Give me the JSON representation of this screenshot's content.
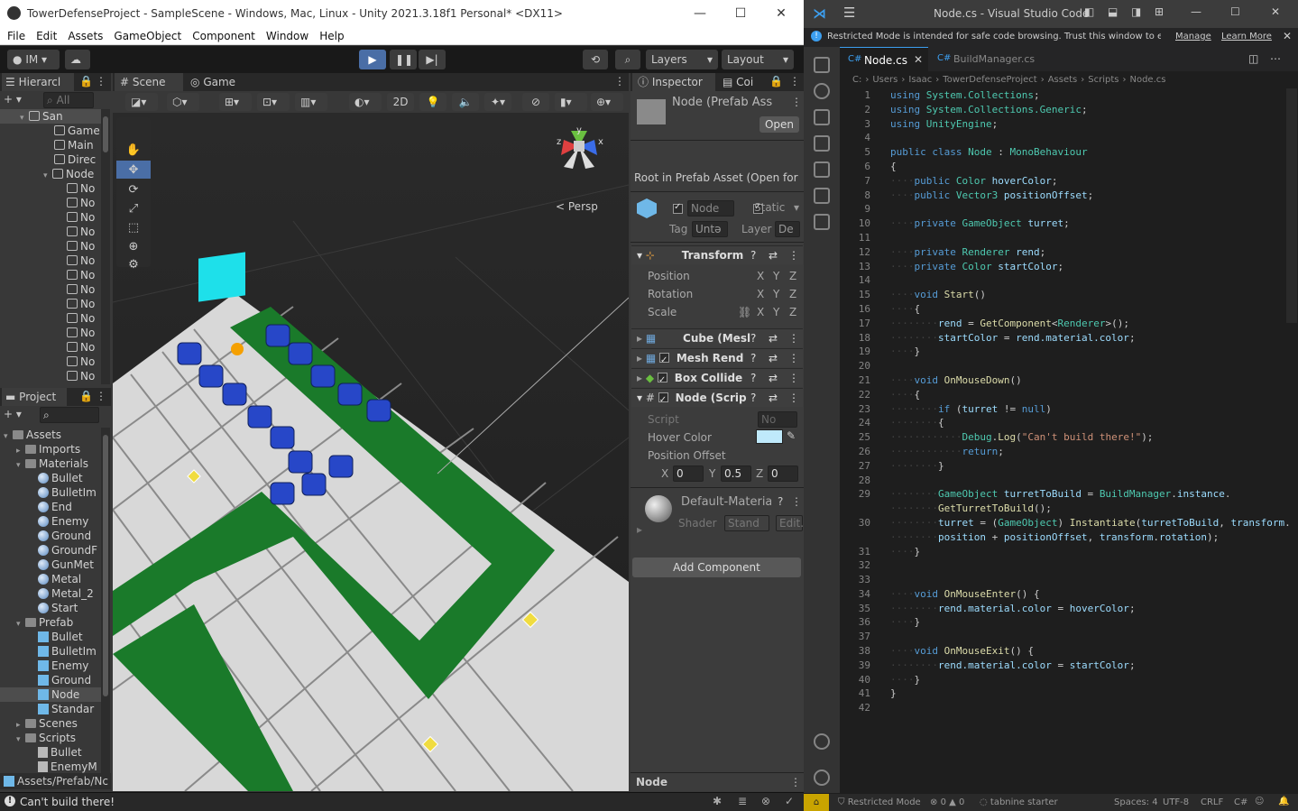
{
  "unity": {
    "title": "TowerDefenseProject - SampleScene - Windows, Mac, Linux - Unity 2021.3.18f1 Personal* <DX11>",
    "menu": [
      "File",
      "Edit",
      "Assets",
      "GameObject",
      "Component",
      "Window",
      "Help"
    ],
    "toolbar": {
      "account": "IM",
      "layers": "Layers",
      "layout": "Layout"
    },
    "hierarchy": {
      "tab": "Hierarcl",
      "search": "All",
      "scene": "San",
      "items": [
        "Game",
        "Main",
        "Direc",
        "Node",
        "No",
        "No",
        "No",
        "No",
        "No",
        "No",
        "No",
        "No",
        "No",
        "No",
        "No",
        "No",
        "No",
        "No"
      ]
    },
    "scene": {
      "tab_scene": "Scene",
      "tab_game": "Game",
      "btn_2d": "2D",
      "persp": "Persp",
      "axis_y": "y",
      "axis_x": "x",
      "axis_z": "z"
    },
    "project": {
      "tab": "Project",
      "tree": [
        {
          "label": "Assets",
          "kind": "folder",
          "level": 0
        },
        {
          "label": "Imports",
          "kind": "folder",
          "level": 1
        },
        {
          "label": "Materials",
          "kind": "folder",
          "level": 1
        },
        {
          "label": "Bullet",
          "kind": "mat",
          "level": 2
        },
        {
          "label": "BulletIm",
          "kind": "mat",
          "level": 2
        },
        {
          "label": "End",
          "kind": "mat",
          "level": 2
        },
        {
          "label": "Enemy",
          "kind": "mat",
          "level": 2
        },
        {
          "label": "Ground",
          "kind": "mat",
          "level": 2
        },
        {
          "label": "GroundF",
          "kind": "mat",
          "level": 2
        },
        {
          "label": "GunMet",
          "kind": "mat",
          "level": 2
        },
        {
          "label": "Metal",
          "kind": "mat",
          "level": 2
        },
        {
          "label": "Metal_2",
          "kind": "mat",
          "level": 2
        },
        {
          "label": "Start",
          "kind": "mat",
          "level": 2
        },
        {
          "label": "Prefab",
          "kind": "folder",
          "level": 1
        },
        {
          "label": "Bullet",
          "kind": "pref",
          "level": 2
        },
        {
          "label": "BulletIm",
          "kind": "pref",
          "level": 2
        },
        {
          "label": "Enemy",
          "kind": "pref",
          "level": 2
        },
        {
          "label": "Ground",
          "kind": "pref",
          "level": 2
        },
        {
          "label": "Node",
          "kind": "pref",
          "level": 2
        },
        {
          "label": "Standar",
          "kind": "pref",
          "level": 2
        },
        {
          "label": "Scenes",
          "kind": "folder",
          "level": 1
        },
        {
          "label": "Scripts",
          "kind": "folder",
          "level": 1
        },
        {
          "label": "Bullet",
          "kind": "scr",
          "level": 2
        },
        {
          "label": "EnemyM",
          "kind": "scr",
          "level": 2
        }
      ],
      "path": "Assets/Prefab/Nc"
    },
    "inspector": {
      "tab": "Inspector",
      "tab2": "Coi",
      "prefab_name": "Node (Prefab Ass",
      "open_btn": "Open",
      "root_msg": "Root in Prefab Asset (Open for fu",
      "obj_name": "Node",
      "static_label": "Static",
      "tag_label": "Tag",
      "tag_value": "Untǝ",
      "layer_label": "Layer",
      "layer_value": "De",
      "transform": "Transform",
      "position": "Position",
      "rotation": "Rotation",
      "scale": "Scale",
      "x": "X",
      "y": "Y",
      "z": "Z",
      "cube": "Cube (Mesl",
      "mesh_renderer": "Mesh Rend",
      "box_collider": "Box Collide",
      "node_script": "Node (Scrip",
      "script_label": "Script",
      "script_value": "No",
      "hover_color_label": "Hover Color",
      "hover_color": "#bfe9fb",
      "position_offset_label": "Position Offset",
      "offset": {
        "x": "0",
        "y": "0.5",
        "z": "0"
      },
      "material": "Default-Materia",
      "shader_label": "Shader",
      "shader_value": "Stand",
      "edit": "Edit.",
      "add_component": "Add Component",
      "footer": "Node"
    },
    "status": "Can't build there!"
  },
  "vscode": {
    "title": "Node.cs - Visual Studio Code",
    "banner": "Restricted Mode is intended for safe code browsing. Trust this window to enable all...",
    "banner_manage": "Manage",
    "banner_learn": "Learn More",
    "tabs": [
      {
        "label": "Node.cs",
        "active": true
      },
      {
        "label": "BuildManager.cs",
        "active": false
      }
    ],
    "breadcrumb": [
      "C:",
      "Users",
      "Isaac",
      "TowerDefenseProject",
      "Assets",
      "Scripts",
      "Node.cs"
    ],
    "code": [
      [
        [
          "using",
          "kw"
        ],
        [
          " ",
          ""
        ],
        [
          "System.Collections",
          "ty"
        ],
        [
          ";",
          ""
        ]
      ],
      [
        [
          "using",
          "kw"
        ],
        [
          " ",
          ""
        ],
        [
          "System.Collections.Generic",
          "ty"
        ],
        [
          ";",
          ""
        ]
      ],
      [
        [
          "using",
          "kw"
        ],
        [
          " ",
          ""
        ],
        [
          "UnityEngine",
          "ty"
        ],
        [
          ";",
          ""
        ]
      ],
      [],
      [
        [
          "public",
          "kw"
        ],
        [
          " ",
          ""
        ],
        [
          "class",
          "kw"
        ],
        [
          " ",
          ""
        ],
        [
          "Node",
          "ty"
        ],
        [
          " : ",
          ""
        ],
        [
          "MonoBehaviour",
          "ty"
        ]
      ],
      [
        [
          "{",
          ""
        ]
      ],
      [
        [
          "····",
          "ws"
        ],
        [
          "public",
          "kw"
        ],
        [
          " ",
          ""
        ],
        [
          "Color",
          "ty"
        ],
        [
          " ",
          ""
        ],
        [
          "hoverColor",
          "vr"
        ],
        [
          ";",
          ""
        ]
      ],
      [
        [
          "····",
          "ws"
        ],
        [
          "public",
          "kw"
        ],
        [
          " ",
          ""
        ],
        [
          "Vector3",
          "ty"
        ],
        [
          " ",
          ""
        ],
        [
          "positionOffset",
          "vr"
        ],
        [
          ";",
          ""
        ]
      ],
      [],
      [
        [
          "····",
          "ws"
        ],
        [
          "private",
          "kw"
        ],
        [
          " ",
          ""
        ],
        [
          "GameObject",
          "ty"
        ],
        [
          " ",
          ""
        ],
        [
          "turret",
          "vr"
        ],
        [
          ";",
          ""
        ]
      ],
      [],
      [
        [
          "····",
          "ws"
        ],
        [
          "private",
          "kw"
        ],
        [
          " ",
          ""
        ],
        [
          "Renderer",
          "ty"
        ],
        [
          " ",
          ""
        ],
        [
          "rend",
          "vr"
        ],
        [
          ";",
          ""
        ]
      ],
      [
        [
          "····",
          "ws"
        ],
        [
          "private",
          "kw"
        ],
        [
          " ",
          ""
        ],
        [
          "Color",
          "ty"
        ],
        [
          " ",
          ""
        ],
        [
          "startColor",
          "vr"
        ],
        [
          ";",
          ""
        ]
      ],
      [],
      [
        [
          "····",
          "ws"
        ],
        [
          "void",
          "kw"
        ],
        [
          " ",
          ""
        ],
        [
          "Start",
          "fn"
        ],
        [
          "()",
          ""
        ]
      ],
      [
        [
          "····",
          "ws"
        ],
        [
          "{",
          ""
        ]
      ],
      [
        [
          "········",
          "ws"
        ],
        [
          "rend",
          "vr"
        ],
        [
          " = ",
          ""
        ],
        [
          "GetComponent",
          "fn"
        ],
        [
          "<",
          ""
        ],
        [
          "Renderer",
          "ty"
        ],
        [
          ">();",
          ""
        ]
      ],
      [
        [
          "········",
          "ws"
        ],
        [
          "startColor",
          "vr"
        ],
        [
          " = ",
          ""
        ],
        [
          "rend.material.color",
          "vr"
        ],
        [
          ";",
          ""
        ]
      ],
      [
        [
          "····",
          "ws"
        ],
        [
          "}",
          ""
        ]
      ],
      [],
      [
        [
          "····",
          "ws"
        ],
        [
          "void",
          "kw"
        ],
        [
          " ",
          ""
        ],
        [
          "OnMouseDown",
          "fn"
        ],
        [
          "()",
          ""
        ]
      ],
      [
        [
          "····",
          "ws"
        ],
        [
          "{",
          ""
        ]
      ],
      [
        [
          "········",
          "ws"
        ],
        [
          "if",
          "kw"
        ],
        [
          " (",
          ""
        ],
        [
          "turret",
          "vr"
        ],
        [
          " != ",
          ""
        ],
        [
          "null",
          "kw"
        ],
        [
          ")",
          ""
        ]
      ],
      [
        [
          "········",
          "ws"
        ],
        [
          "{",
          ""
        ]
      ],
      [
        [
          "············",
          "ws"
        ],
        [
          "Debug",
          "ty"
        ],
        [
          ".",
          ""
        ],
        [
          "Log",
          "fn"
        ],
        [
          "(",
          ""
        ],
        [
          "\"Can't build there!\"",
          "st"
        ],
        [
          ");",
          ""
        ]
      ],
      [
        [
          "············",
          "ws"
        ],
        [
          "return",
          "kw"
        ],
        [
          ";",
          ""
        ]
      ],
      [
        [
          "········",
          "ws"
        ],
        [
          "}",
          ""
        ]
      ],
      [],
      [
        [
          "········",
          "ws"
        ],
        [
          "GameObject",
          "ty"
        ],
        [
          " ",
          ""
        ],
        [
          "turretToBuild",
          "vr"
        ],
        [
          " = ",
          ""
        ],
        [
          "BuildManager",
          "ty"
        ],
        [
          ".",
          ""
        ],
        [
          "instance",
          "vr"
        ],
        [
          ".",
          ""
        ]
      ],
      [
        [
          "········",
          "ws"
        ],
        [
          "GetTurretToBuild",
          "fn"
        ],
        [
          "();",
          ""
        ]
      ],
      [
        [
          "········",
          "ws"
        ],
        [
          "turret",
          "vr"
        ],
        [
          " = (",
          ""
        ],
        [
          "GameObject",
          "ty"
        ],
        [
          ") ",
          ""
        ],
        [
          "Instantiate",
          "fn"
        ],
        [
          "(",
          ""
        ],
        [
          "turretToBuild",
          "vr"
        ],
        [
          ", ",
          ""
        ],
        [
          "transform",
          "vr"
        ],
        [
          ".",
          ""
        ]
      ],
      [
        [
          "········",
          "ws"
        ],
        [
          "position",
          "vr"
        ],
        [
          " + ",
          ""
        ],
        [
          "positionOffset",
          "vr"
        ],
        [
          ", ",
          ""
        ],
        [
          "transform",
          "vr"
        ],
        [
          ".",
          ""
        ],
        [
          "rotation",
          "vr"
        ],
        [
          ");",
          ""
        ]
      ],
      [
        [
          "····",
          "ws"
        ],
        [
          "}",
          ""
        ]
      ],
      [],
      [],
      [
        [
          "····",
          "ws"
        ],
        [
          "void",
          "kw"
        ],
        [
          " ",
          ""
        ],
        [
          "OnMouseEnter",
          "fn"
        ],
        [
          "() {",
          ""
        ]
      ],
      [
        [
          "········",
          "ws"
        ],
        [
          "rend.material.color",
          "vr"
        ],
        [
          " = ",
          ""
        ],
        [
          "hoverColor",
          "vr"
        ],
        [
          ";",
          ""
        ]
      ],
      [
        [
          "····",
          "ws"
        ],
        [
          "}",
          ""
        ]
      ],
      [],
      [
        [
          "····",
          "ws"
        ],
        [
          "void",
          "kw"
        ],
        [
          " ",
          ""
        ],
        [
          "OnMouseExit",
          "fn"
        ],
        [
          "() {",
          ""
        ]
      ],
      [
        [
          "········",
          "ws"
        ],
        [
          "rend.material.color",
          "vr"
        ],
        [
          " = ",
          ""
        ],
        [
          "startColor",
          "vr"
        ],
        [
          ";",
          ""
        ]
      ],
      [
        [
          "····",
          "ws"
        ],
        [
          "}",
          ""
        ]
      ],
      [
        [
          "}",
          ""
        ]
      ],
      []
    ],
    "line_numbers": [
      "1",
      "2",
      "3",
      "4",
      "5",
      "6",
      "7",
      "8",
      "9",
      "10",
      "11",
      "12",
      "13",
      "14",
      "15",
      "16",
      "17",
      "18",
      "19",
      "20",
      "21",
      "22",
      "23",
      "24",
      "25",
      "26",
      "27",
      "28",
      "29",
      "",
      "30",
      "",
      "31",
      "32",
      "33",
      "34",
      "35",
      "36",
      "37",
      "38",
      "39",
      "40",
      "41",
      "42"
    ],
    "status": {
      "mode": "Restricted Mode",
      "problems": "0 ▲ 0",
      "tabnine": "tabnine starter",
      "spaces": "Spaces: 4",
      "encoding": "UTF-8",
      "eol": "CRLF",
      "lang": "C#"
    }
  }
}
